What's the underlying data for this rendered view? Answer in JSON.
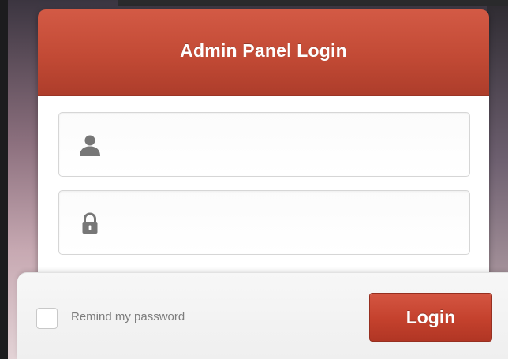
{
  "panel": {
    "title": "Admin Panel Login"
  },
  "fields": {
    "username": {
      "value": "",
      "placeholder": "",
      "icon": "user-icon"
    },
    "password": {
      "value": "",
      "placeholder": "",
      "icon": "lock-icon"
    }
  },
  "footer": {
    "remember_label": "Remind my password",
    "remember_checked": false,
    "login_label": "Login"
  },
  "colors": {
    "accent": "#c24a35",
    "icon": "#777777"
  }
}
